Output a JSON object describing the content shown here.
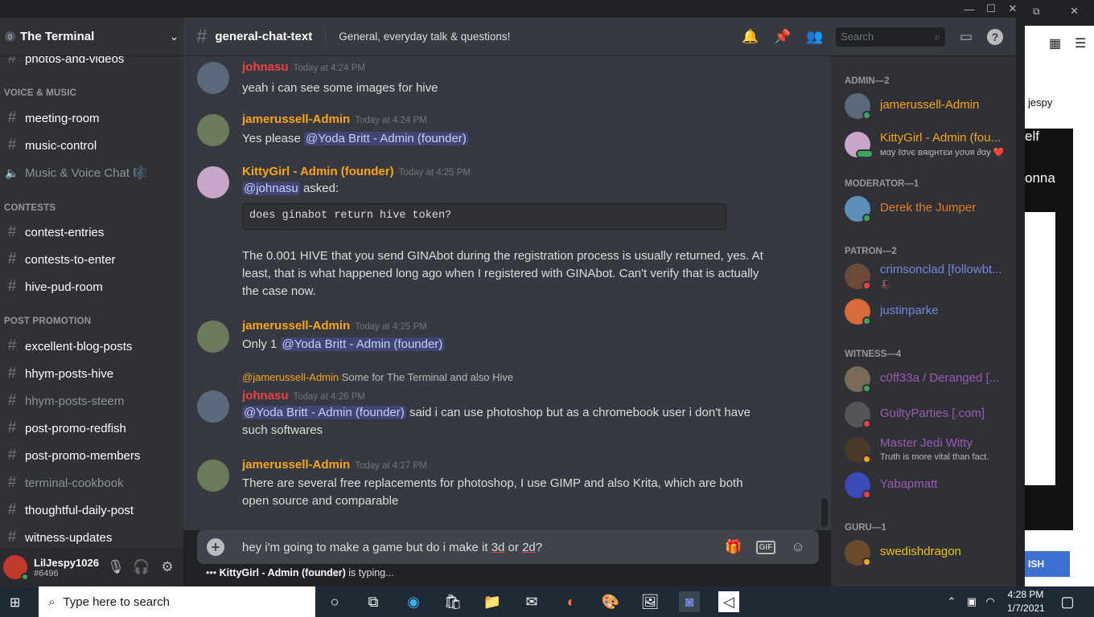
{
  "window": {
    "title": "The Terminal"
  },
  "server": {
    "name": "The Terminal",
    "badge": "0"
  },
  "sidebar": {
    "items": [
      {
        "type": "channel",
        "label": "photos-and-videos",
        "muted": false
      },
      {
        "type": "category",
        "label": "VOICE & MUSIC"
      },
      {
        "type": "channel",
        "label": "meeting-room",
        "muted": false
      },
      {
        "type": "channel",
        "label": "music-control",
        "muted": false
      },
      {
        "type": "voice",
        "label": "Music & Voice Chat 🎼",
        "muted": true
      },
      {
        "type": "category",
        "label": "CONTESTS"
      },
      {
        "type": "channel",
        "label": "contest-entries",
        "muted": false
      },
      {
        "type": "channel",
        "label": "contests-to-enter",
        "muted": false
      },
      {
        "type": "channel",
        "label": "hive-pud-room",
        "muted": false
      },
      {
        "type": "category",
        "label": "POST PROMOTION"
      },
      {
        "type": "channel",
        "label": "excellent-blog-posts",
        "muted": false
      },
      {
        "type": "channel",
        "label": "hhym-posts-hive",
        "muted": false
      },
      {
        "type": "channel",
        "label": "hhym-posts-steem",
        "muted": true
      },
      {
        "type": "channel",
        "label": "post-promo-redfish",
        "muted": false
      },
      {
        "type": "channel",
        "label": "post-promo-members",
        "muted": false
      },
      {
        "type": "channel",
        "label": "terminal-cookbook",
        "muted": true
      },
      {
        "type": "channel",
        "label": "thoughtful-daily-post",
        "muted": false
      },
      {
        "type": "channel",
        "label": "witness-updates",
        "muted": false
      }
    ]
  },
  "user": {
    "name": "LilJespy1026",
    "tag": "#6496"
  },
  "header": {
    "channel": "general-chat-text",
    "topic": "General, everyday talk & questions!",
    "search_placeholder": "Search"
  },
  "messages": [
    {
      "author": "johnasu",
      "color": "#ed4245",
      "time": "Today at 4:24 PM",
      "text": "yeah i can see some images for hive"
    },
    {
      "author": "jamerussell-Admin",
      "color": "#faa61a",
      "time": "Today at 4:24 PM",
      "text_pre": "Yes please ",
      "mention": "@Yoda Britt - Admin (founder)"
    },
    {
      "author": "KittyGirl - Admin (founder)",
      "color": "#faa61a",
      "time": "Today at 4:25 PM",
      "mention": "@johnasu",
      "text_post": " asked:",
      "code": "does ginabot return hive token?",
      "text2": "The 0.001 HIVE that you send GINAbot during the registration process is usually returned, yes. At least, that is what happened long ago when I registered with GINAbot. Can't verify that is actually the case now."
    },
    {
      "author": "jamerussell-Admin",
      "color": "#faa61a",
      "time": "Today at 4:25 PM",
      "text_pre": "Only 1 ",
      "mention": "@Yoda Britt - Admin (founder)"
    },
    {
      "author": "johnasu",
      "color": "#ed4245",
      "time": "Today at 4:26 PM",
      "reply_author": "@jamerussell-Admin",
      "reply_text": "Some for The Terminal and also Hive",
      "mention": "@Yoda Britt - Admin (founder)",
      "text_post": " said i can use photoshop but as a chromebook user i don't have such softwares"
    },
    {
      "author": "jamerussell-Admin",
      "color": "#faa61a",
      "time": "Today at 4:27 PM",
      "text": "There are several free replacements for photoshop, I use GIMP and also Krita, which are both open source and comparable"
    }
  ],
  "composer": {
    "pre": "hey i'm going to make a game but do i make it ",
    "w1": "3d",
    "mid": " or ",
    "w2": "2d",
    "post": "?"
  },
  "typing": {
    "name": "KittyGirl - Admin (founder)",
    "text": " is typing..."
  },
  "members": [
    {
      "type": "cat",
      "label": "ADMIN—2"
    },
    {
      "name": "jamerussell-Admin",
      "color": "#faa61a",
      "status": "online"
    },
    {
      "name": "KittyGirl - Admin (fou...",
      "color": "#faa61a",
      "status": "mobile",
      "sub": "мαу ℓσνє вяιgнтєи уσυя ∂αу ❤️"
    },
    {
      "type": "cat",
      "label": "MODERATOR—1"
    },
    {
      "name": "Derek the Jumper",
      "color": "#e67e22",
      "status": "online"
    },
    {
      "type": "cat",
      "label": "PATRON—2"
    },
    {
      "name": "crimsonclad [followbt...",
      "color": "#7289da",
      "status": "dnd",
      "sub": "🎩"
    },
    {
      "name": "justinparke",
      "color": "#7289da",
      "status": "online"
    },
    {
      "type": "cat",
      "label": "WITNESS—4"
    },
    {
      "name": "c0ff33a / Deranged [...",
      "color": "#9b59b6",
      "status": "online"
    },
    {
      "name": "GuiltyParties [.com]",
      "color": "#9b59b6",
      "status": "dnd"
    },
    {
      "name": "Master Jedi Witty",
      "color": "#9b59b6",
      "status": "idle",
      "sub": "Truth is more vital than fact."
    },
    {
      "name": "Yabapmatt",
      "color": "#9b59b6",
      "status": "dnd"
    },
    {
      "type": "cat",
      "label": "GURU—1"
    },
    {
      "name": "swedishdragon",
      "color": "#f1c40f",
      "status": "idle"
    }
  ],
  "right_app": {
    "user": "jespy",
    "text1": "elf",
    "text2": "onna",
    "btn": "ISH"
  },
  "taskbar": {
    "search_placeholder": "Type here to search",
    "time": "4:28 PM",
    "date": "1/7/2021"
  }
}
